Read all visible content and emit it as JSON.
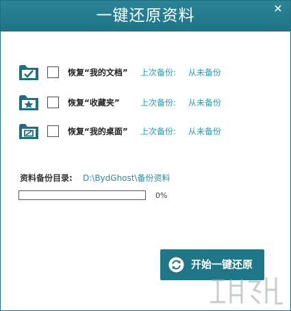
{
  "window": {
    "title": "一键还原资料",
    "close_glyph": "✕"
  },
  "items": [
    {
      "label": "恢复“我的文档”",
      "status_label": "上次备份:",
      "status_value": "从未备份",
      "icon": "documents-folder-check-icon",
      "checked": false
    },
    {
      "label": "恢复“收藏夹”",
      "status_label": "上次备份:",
      "status_value": "从未备份",
      "icon": "favorites-folder-star-icon",
      "checked": false
    },
    {
      "label": "恢复“我的桌面”",
      "status_label": "上次备份:",
      "status_value": "从未备份",
      "icon": "desktop-folder-icon",
      "checked": false
    }
  ],
  "backup_dir": {
    "label": "资料备份目录:",
    "path": "D:\\BydGhost\\备份资料"
  },
  "progress": {
    "value": 0,
    "text": "0%"
  },
  "start_button": {
    "label": "开始一键还原",
    "icon": "refresh-icon"
  },
  "colors": {
    "title_bar": "#1d7486",
    "accent_text": "#2a9ab4",
    "button": "#1e7687"
  }
}
